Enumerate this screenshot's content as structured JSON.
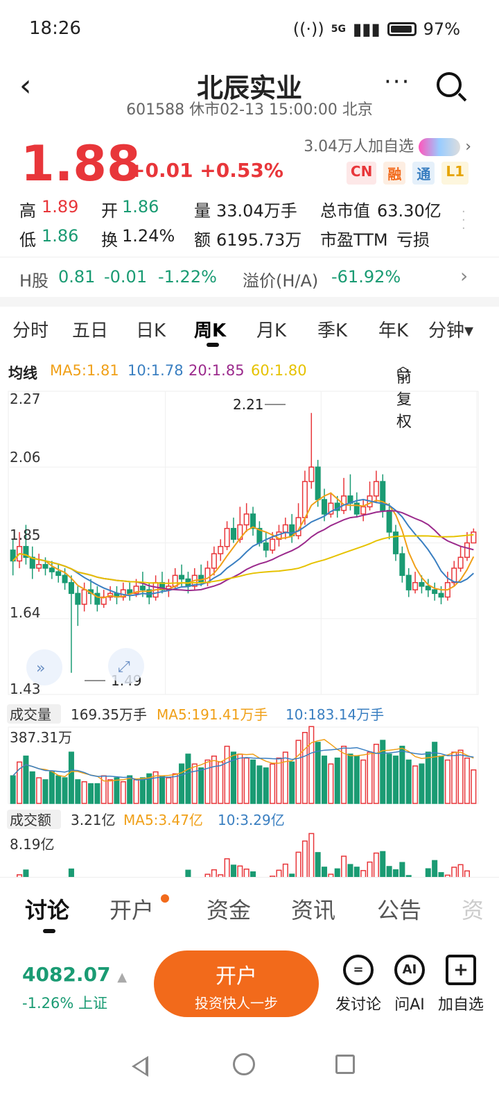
{
  "status": {
    "time": "18:26",
    "network": "5G",
    "battery": "97%"
  },
  "header": {
    "title": "北辰实业",
    "subtitle": "601588 休市02-13 15:00:00 北京",
    "back_icon": "chevron-left-icon",
    "more_icon": "more-icon",
    "search_icon": "search-icon"
  },
  "quote": {
    "price": "1.88",
    "change": "+0.01",
    "change_pct": "+0.53%",
    "watchers": "3.04万人加自选",
    "tags": [
      "CN",
      "融",
      "通",
      "L1"
    ]
  },
  "stats": {
    "high_label": "高",
    "high": "1.89",
    "open_label": "开",
    "open": "1.86",
    "vol_label": "量",
    "vol": "33.04万手",
    "cap_label": "总市值",
    "cap": "63.30亿",
    "low_label": "低",
    "low": "1.86",
    "turn_label": "换",
    "turn": "1.24%",
    "amt_label": "额",
    "amt": "6195.73万",
    "pe_label": "市盈TTM",
    "pe": "亏损"
  },
  "hshare": {
    "label": "H股",
    "price": "0.81",
    "change": "-0.01",
    "change_pct": "-1.22%",
    "premium_label": "溢价(H/A)",
    "premium": "-61.92%"
  },
  "tabs": [
    "分时",
    "五日",
    "日K",
    "周K",
    "月K",
    "季K",
    "年K",
    "分钟▾"
  ],
  "ma": {
    "label": "均线",
    "ma5": "MA5:1.81",
    "ma10": "10:1.78",
    "ma20": "20:1.85",
    "ma60": "60:1.80",
    "adjust": "前复权"
  },
  "chart_labels": {
    "y_top": "2.27",
    "y2": "2.06",
    "y3": "1.85",
    "y4": "1.64",
    "y_bottom": "1.43",
    "peak": "2.21",
    "trough": "1.49"
  },
  "volume": {
    "label": "成交量",
    "value": "169.35万手",
    "ma5": "MA5:191.41万手",
    "ma10": "10:183.14万手",
    "max": "387.31万"
  },
  "amount": {
    "label": "成交额",
    "value": "3.21亿",
    "ma5": "MA5:3.47亿",
    "ma10": "10:3.29亿",
    "max": "8.19亿"
  },
  "bottom_tabs": [
    "讨论",
    "开户",
    "资金",
    "资讯",
    "公告",
    "资"
  ],
  "index": {
    "value": "4082.07",
    "sub": "-1.26% 上证"
  },
  "open_button": {
    "line1": "开户",
    "line2": "投资快人一步"
  },
  "actions": [
    {
      "label": "发讨论",
      "icon": "comment-icon"
    },
    {
      "label": "问AI",
      "icon": "ai-icon"
    },
    {
      "label": "加自选",
      "icon": "add-icon"
    }
  ],
  "colors": {
    "up": "#e8363a",
    "down": "#1a9b73",
    "ma5": "#f0a018",
    "ma10": "#3a7fc1",
    "ma20": "#9b2a8c",
    "ma60": "#e6c200",
    "accent": "#f26a1b"
  },
  "chart_data": {
    "type": "candlestick",
    "ylim": [
      1.43,
      2.27
    ],
    "candles": [
      [
        1.83,
        1.8,
        1.86,
        1.76
      ],
      [
        1.8,
        1.84,
        1.88,
        1.78
      ],
      [
        1.84,
        1.81,
        1.9,
        1.79
      ],
      [
        1.81,
        1.78,
        1.84,
        1.75
      ],
      [
        1.78,
        1.79,
        1.82,
        1.77
      ],
      [
        1.79,
        1.78,
        1.81,
        1.76
      ],
      [
        1.78,
        1.77,
        1.8,
        1.75
      ],
      [
        1.77,
        1.76,
        1.79,
        1.74
      ],
      [
        1.76,
        1.74,
        1.78,
        1.72
      ],
      [
        1.74,
        1.71,
        1.76,
        1.49
      ],
      [
        1.71,
        1.68,
        1.73,
        1.62
      ],
      [
        1.68,
        1.72,
        1.74,
        1.66
      ],
      [
        1.72,
        1.71,
        1.75,
        1.68
      ],
      [
        1.71,
        1.68,
        1.73,
        1.66
      ],
      [
        1.68,
        1.7,
        1.72,
        1.67
      ],
      [
        1.7,
        1.71,
        1.73,
        1.69
      ],
      [
        1.71,
        1.7,
        1.73,
        1.68
      ],
      [
        1.7,
        1.72,
        1.74,
        1.69
      ],
      [
        1.72,
        1.71,
        1.74,
        1.69
      ],
      [
        1.71,
        1.73,
        1.75,
        1.7
      ],
      [
        1.73,
        1.72,
        1.77,
        1.7
      ],
      [
        1.72,
        1.7,
        1.74,
        1.68
      ],
      [
        1.7,
        1.74,
        1.76,
        1.69
      ],
      [
        1.74,
        1.72,
        1.77,
        1.71
      ],
      [
        1.72,
        1.73,
        1.75,
        1.7
      ],
      [
        1.73,
        1.76,
        1.78,
        1.72
      ],
      [
        1.76,
        1.75,
        1.79,
        1.73
      ],
      [
        1.75,
        1.73,
        1.77,
        1.71
      ],
      [
        1.73,
        1.76,
        1.78,
        1.72
      ],
      [
        1.76,
        1.74,
        1.79,
        1.73
      ],
      [
        1.74,
        1.78,
        1.8,
        1.73
      ],
      [
        1.78,
        1.82,
        1.84,
        1.76
      ],
      [
        1.82,
        1.84,
        1.86,
        1.8
      ],
      [
        1.84,
        1.89,
        1.91,
        1.83
      ],
      [
        1.89,
        1.86,
        1.92,
        1.85
      ],
      [
        1.86,
        1.9,
        1.95,
        1.85
      ],
      [
        1.9,
        1.93,
        1.96,
        1.88
      ],
      [
        1.93,
        1.89,
        1.95,
        1.87
      ],
      [
        1.89,
        1.85,
        1.91,
        1.84
      ],
      [
        1.85,
        1.83,
        1.88,
        1.81
      ],
      [
        1.83,
        1.86,
        1.88,
        1.82
      ],
      [
        1.86,
        1.88,
        1.9,
        1.84
      ],
      [
        1.88,
        1.9,
        1.92,
        1.86
      ],
      [
        1.9,
        1.87,
        1.93,
        1.85
      ],
      [
        1.87,
        1.92,
        1.96,
        1.86
      ],
      [
        1.92,
        2.02,
        2.05,
        1.9
      ],
      [
        2.02,
        2.06,
        2.21,
        2.0
      ],
      [
        2.06,
        1.97,
        2.08,
        1.95
      ],
      [
        1.97,
        1.93,
        2.0,
        1.91
      ],
      [
        1.93,
        1.96,
        1.99,
        1.92
      ],
      [
        1.96,
        1.94,
        1.98,
        1.92
      ],
      [
        1.94,
        1.98,
        2.03,
        1.93
      ],
      [
        1.98,
        1.96,
        2.04,
        1.94
      ],
      [
        1.96,
        1.93,
        1.99,
        1.92
      ],
      [
        1.93,
        1.95,
        1.97,
        1.91
      ],
      [
        1.95,
        1.98,
        2.02,
        1.94
      ],
      [
        1.98,
        2.02,
        2.05,
        1.96
      ],
      [
        2.02,
        1.94,
        2.04,
        1.92
      ],
      [
        1.94,
        1.88,
        1.96,
        1.86
      ],
      [
        1.88,
        1.82,
        1.9,
        1.8
      ],
      [
        1.82,
        1.76,
        1.84,
        1.74
      ],
      [
        1.76,
        1.72,
        1.78,
        1.7
      ],
      [
        1.72,
        1.74,
        1.77,
        1.71
      ],
      [
        1.74,
        1.73,
        1.76,
        1.71
      ],
      [
        1.73,
        1.72,
        1.75,
        1.7
      ],
      [
        1.72,
        1.71,
        1.74,
        1.69
      ],
      [
        1.71,
        1.7,
        1.73,
        1.68
      ],
      [
        1.7,
        1.74,
        1.77,
        1.69
      ],
      [
        1.74,
        1.78,
        1.8,
        1.73
      ],
      [
        1.78,
        1.81,
        1.84,
        1.77
      ],
      [
        1.81,
        1.85,
        1.88,
        1.8
      ],
      [
        1.85,
        1.88,
        1.89,
        1.86
      ]
    ],
    "volume": [
      1.4,
      2.1,
      2.4,
      1.6,
      1.3,
      1.2,
      1.6,
      1.4,
      1.3,
      2.6,
      1.2,
      1.1,
      1.0,
      1.0,
      1.4,
      1.2,
      1.3,
      1.1,
      1.4,
      1.2,
      1.3,
      1.5,
      1.6,
      1.4,
      1.3,
      1.5,
      2.0,
      2.5,
      2.0,
      1.8,
      2.2,
      2.4,
      2.1,
      2.9,
      2.6,
      2.5,
      2.3,
      2.2,
      1.9,
      1.8,
      2.0,
      2.3,
      2.6,
      2.1,
      3.2,
      3.6,
      3.9,
      3.1,
      2.4,
      2.0,
      2.3,
      2.9,
      2.5,
      2.4,
      2.2,
      2.6,
      3.0,
      3.2,
      2.5,
      2.4,
      2.9,
      2.2,
      1.9,
      2.0,
      2.6,
      3.1,
      2.4,
      2.2,
      2.6,
      2.7,
      2.3,
      1.7
    ],
    "vol_ylim": [
      0,
      3.8731
    ]
  }
}
